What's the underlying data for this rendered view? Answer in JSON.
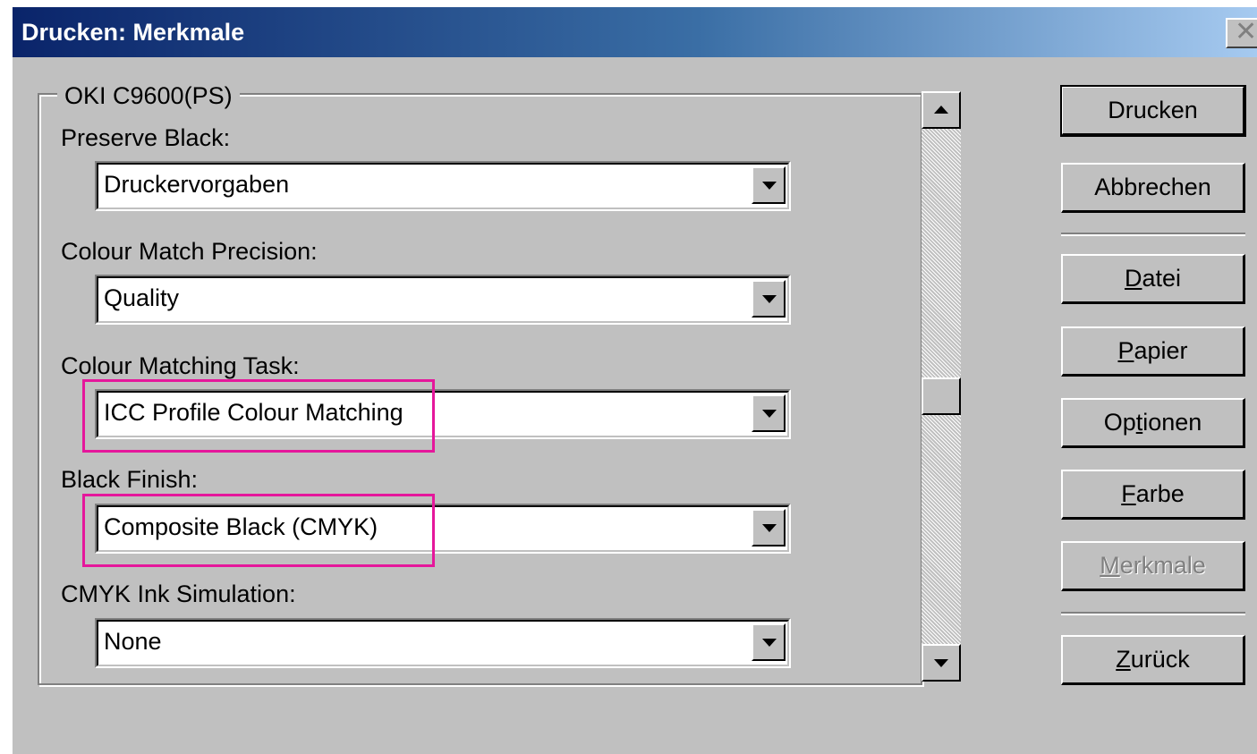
{
  "window": {
    "title": "Drucken: Merkmale",
    "close_glyph": "✕"
  },
  "group": {
    "legend": "OKI C9600(PS)"
  },
  "fields": [
    {
      "label": "Preserve Black:",
      "value": "Druckervorgaben",
      "highlighted": false
    },
    {
      "label": "Colour Match Precision:",
      "value": "Quality",
      "highlighted": false
    },
    {
      "label": "Colour Matching Task:",
      "value": "ICC Profile Colour Matching",
      "highlighted": true
    },
    {
      "label": "Black Finish:",
      "value": "Composite Black (CMYK)",
      "highlighted": true
    },
    {
      "label": "CMYK Ink Simulation:",
      "value": "None",
      "highlighted": false
    }
  ],
  "buttons": {
    "print": "Drucken",
    "cancel": "Abbrechen",
    "file_pre": "",
    "file_key": "D",
    "file_post": "atei",
    "paper_pre": "",
    "paper_key": "P",
    "paper_post": "apier",
    "options_pre": "Op",
    "options_key": "t",
    "options_post": "ionen",
    "color_pre": "",
    "color_key": "F",
    "color_post": "arbe",
    "features_pre": "",
    "features_key": "M",
    "features_post": "erkmale",
    "back_pre": "",
    "back_key": "Z",
    "back_post": "urück"
  },
  "colors": {
    "title_bar_start": "#0a246a",
    "title_bar_end": "#a6caf0",
    "dialog_face": "#c0c0c0",
    "highlight_outline": "#e5179b"
  },
  "icons": {
    "combo_arrow": "chevron-down-icon",
    "scroll_up": "arrow-up-icon",
    "scroll_down": "arrow-down-icon",
    "close": "close-icon"
  }
}
